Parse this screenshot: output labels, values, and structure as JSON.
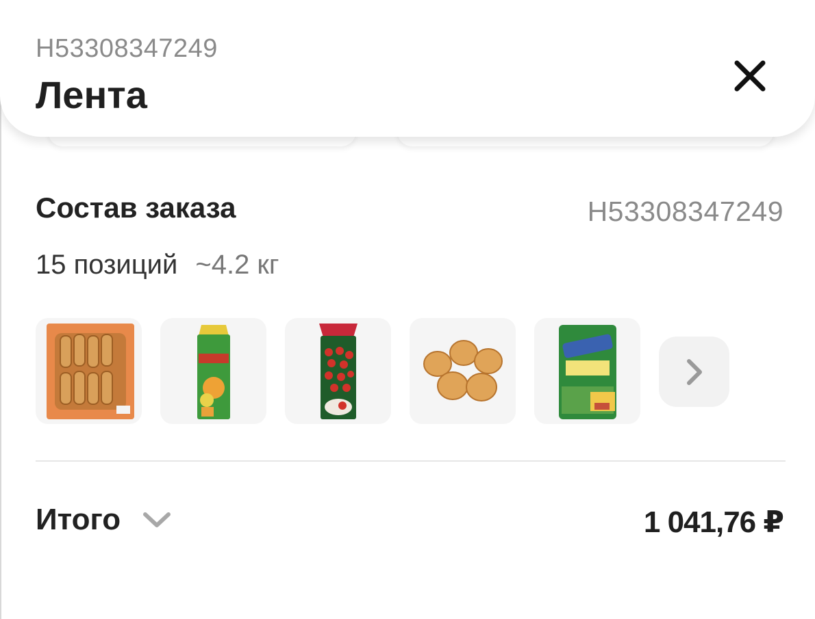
{
  "header": {
    "order_number": "H53308347249",
    "store_name": "Лента",
    "close_icon": "close-icon"
  },
  "order": {
    "title": "Состав заказа",
    "order_number": "H53308347249",
    "positions": "15 позиций",
    "weight": "~4.2 кг",
    "thumbnails": [
      {
        "name": "bakery-box-thumbnail"
      },
      {
        "name": "juice-pack-thumbnail"
      },
      {
        "name": "cherry-tomatoes-thumbnail"
      },
      {
        "name": "onions-thumbnail"
      },
      {
        "name": "cheese-pack-thumbnail"
      }
    ],
    "more_icon": "chevron-right-icon"
  },
  "total": {
    "label": "Итого",
    "value": "1 041,76 ₽",
    "expand_icon": "chevron-down-icon"
  },
  "colors": {
    "secondary_text": "#8a8a8a",
    "primary_text": "#222222",
    "thumb_background": "#f5f5f5"
  }
}
